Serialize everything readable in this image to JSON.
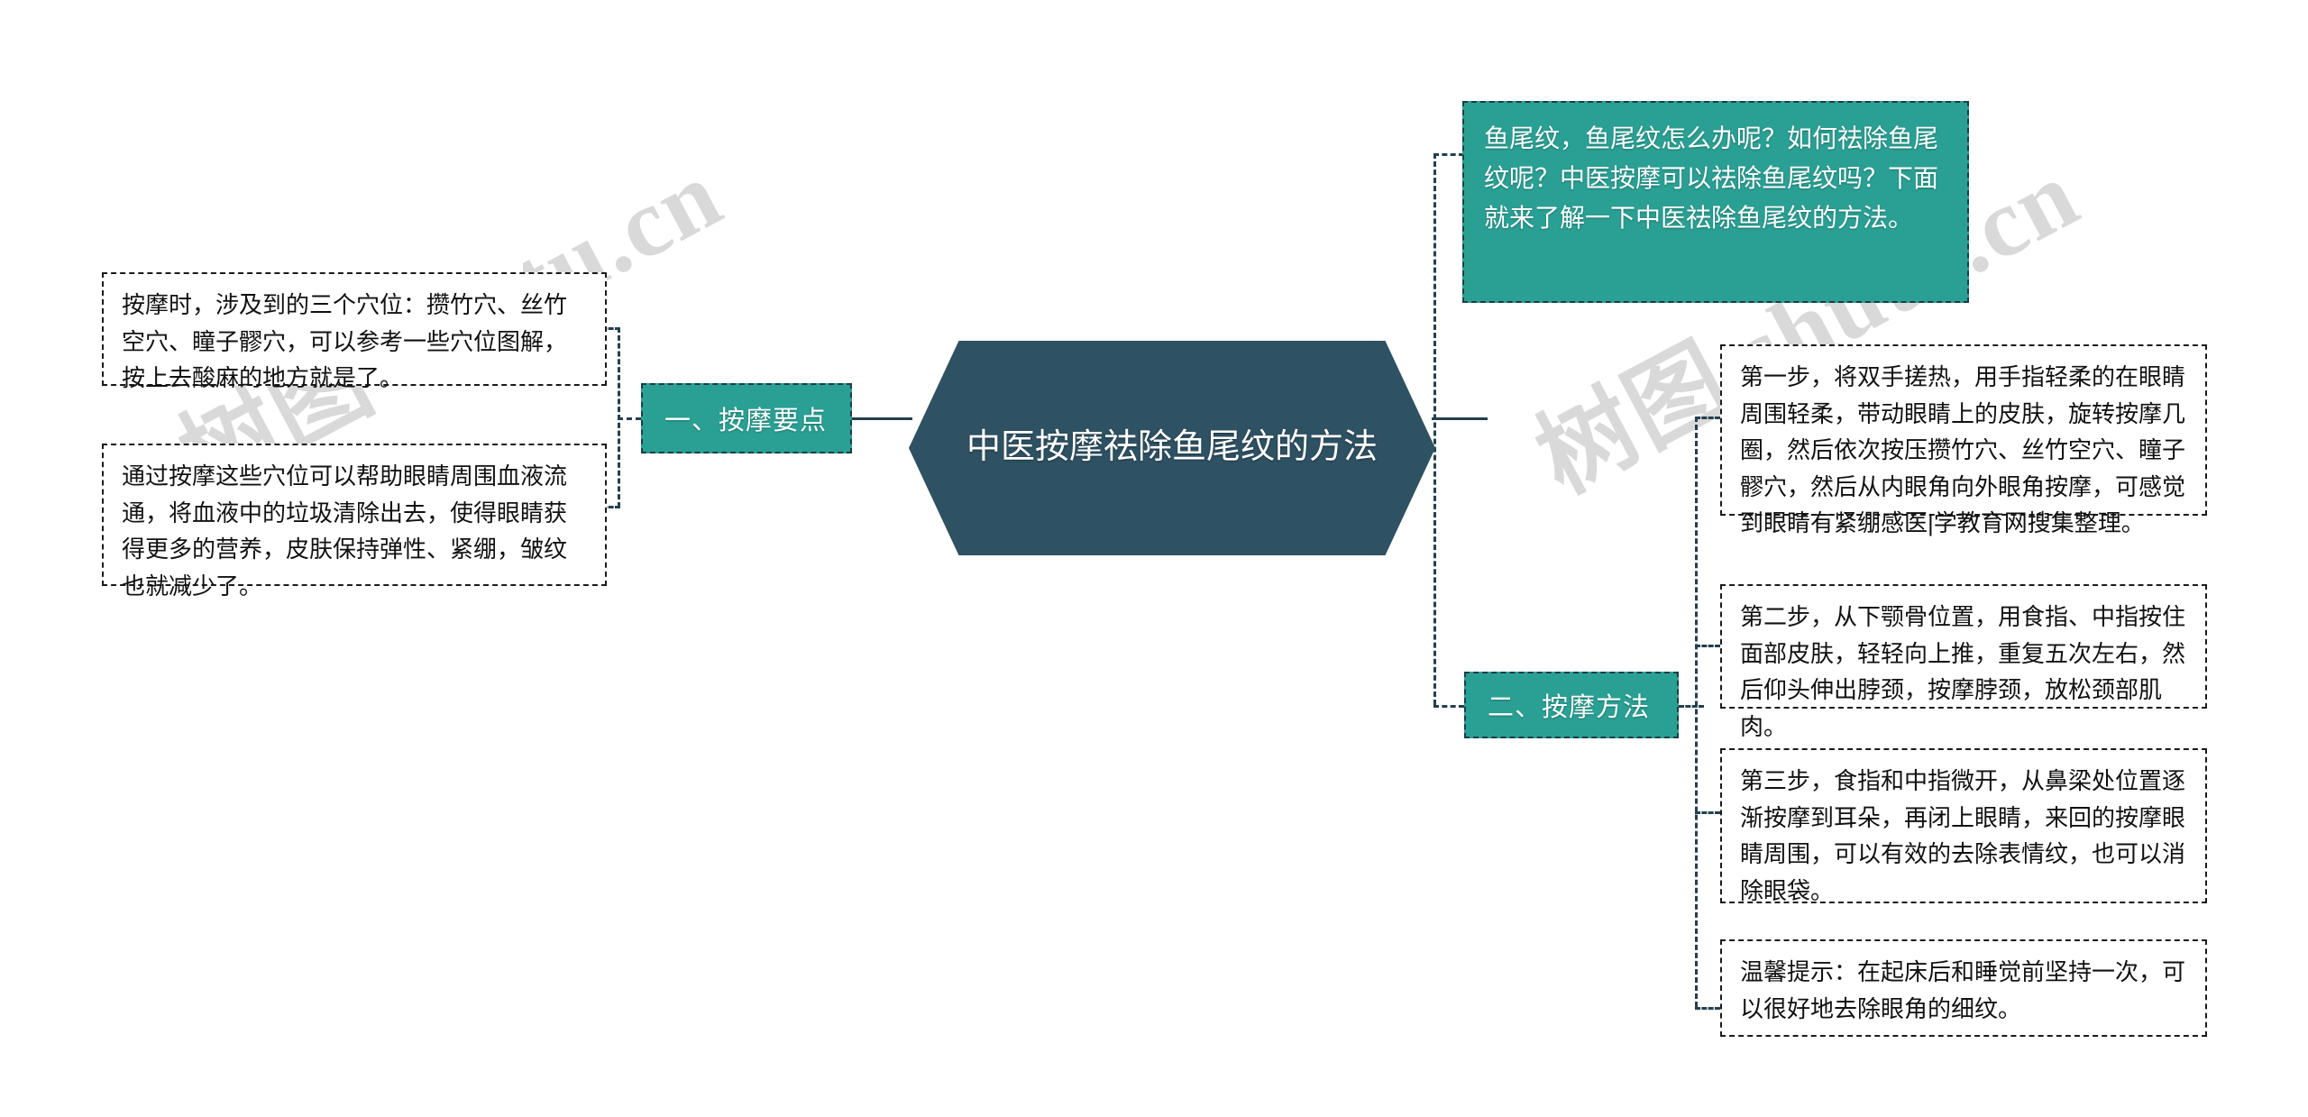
{
  "page": {
    "title": "中医按摩祛除鱼尾纹的方法",
    "background_color": "#ffffff"
  },
  "colors": {
    "root_node": "#2e5163",
    "branch_accent": "#2aa094",
    "line": "#23404e",
    "leaf_border": "#1a1a1a",
    "leaf_text": "#111111",
    "watermark": "#d9d9d9"
  },
  "watermarks": [
    {
      "text": "树图 shutu.cn",
      "position": "left"
    },
    {
      "text": "树图 shutu.cn",
      "position": "right"
    }
  ],
  "root": {
    "label": "中医按摩祛除鱼尾纹的方法"
  },
  "intro": {
    "text": "鱼尾纹，鱼尾纹怎么办呢？如何祛除鱼尾纹呢？中医按摩可以祛除鱼尾纹吗？下面就来了解一下中医祛除鱼尾纹的方法。"
  },
  "branches": [
    {
      "id": "branch-massage-key-points",
      "label": "一、按摩要点",
      "side": "left",
      "leaves": [
        {
          "id": "leaf-acupoints",
          "text": "按摩时，涉及到的三个穴位：攒竹穴、丝竹空穴、瞳子髎穴，可以参考一些穴位图解，按上去酸麻的地方就是了。"
        },
        {
          "id": "leaf-benefits",
          "text": "通过按摩这些穴位可以帮助眼睛周围血液流通，将血液中的垃圾清除出去，使得眼睛获得更多的营养，皮肤保持弹性、紧绷，皱纹也就减少了。"
        }
      ]
    },
    {
      "id": "branch-massage-method",
      "label": "二、按摩方法",
      "side": "right",
      "leaves": [
        {
          "id": "leaf-step-1",
          "text": "第一步，将双手搓热，用手指轻柔的在眼睛周围轻柔，带动眼睛上的皮肤，旋转按摩几圈，然后依次按压攒竹穴、丝竹空穴、瞳子髎穴，然后从内眼角向外眼角按摩，可感觉到眼睛有紧绷感医|学教育网搜集整理。"
        },
        {
          "id": "leaf-step-2",
          "text": "第二步，从下颚骨位置，用食指、中指按住面部皮肤，轻轻向上推，重复五次左右，然后仰头伸出脖颈，按摩脖颈，放松颈部肌肉。"
        },
        {
          "id": "leaf-step-3",
          "text": "第三步，食指和中指微开，从鼻梁处位置逐渐按摩到耳朵，再闭上眼睛，来回的按摩眼睛周围，可以有效的去除表情纹，也可以消除眼袋。"
        },
        {
          "id": "leaf-tip",
          "text": "温馨提示：在起床后和睡觉前坚持一次，可以很好地去除眼角的细纹。"
        }
      ]
    }
  ]
}
